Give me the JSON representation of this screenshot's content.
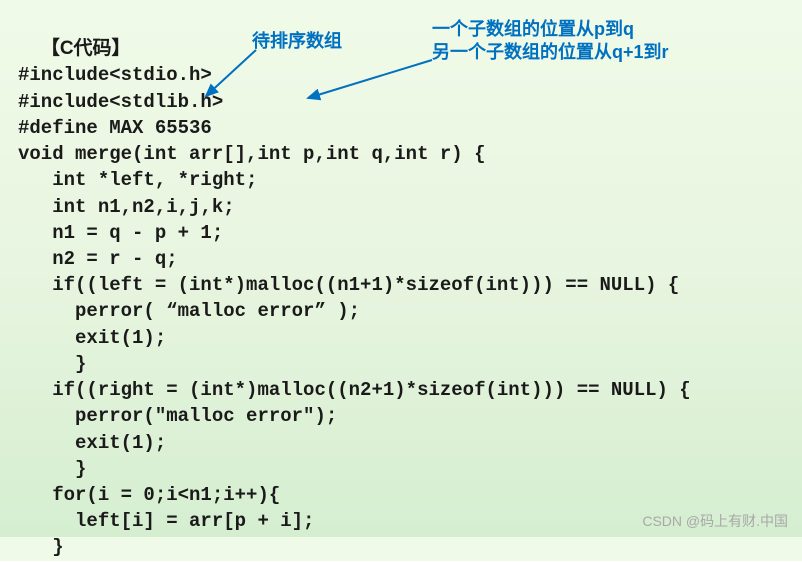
{
  "header": "【C代码】",
  "code_lines": [
    "#include<stdio.h>",
    "#include<stdlib.h>",
    "#define MAX 65536",
    "void merge(int arr[],int p,int q,int r) {",
    "   int *left, *right;",
    "   int n1,n2,i,j,k;",
    "   n1 = q - p + 1;",
    "   n2 = r - q;",
    "   if((left = (int*)malloc((n1+1)*sizeof(int))) == NULL) {",
    "     perror( “malloc error” );",
    "     exit(1);",
    "     }",
    "   if((right = (int*)malloc((n2+1)*sizeof(int))) == NULL) {",
    "     perror(\"malloc error\");",
    "     exit(1);",
    "     }",
    "   for(i = 0;i<n1;i++){",
    "     left[i] = arr[p + i];",
    "   }"
  ],
  "annotations": {
    "annotation1": "待排序数组",
    "annotation2_line1": "一个子数组的位置从p到q",
    "annotation2_line2": "另一个子数组的位置从q+1到r"
  },
  "watermark": "CSDN @码上有财.中国"
}
